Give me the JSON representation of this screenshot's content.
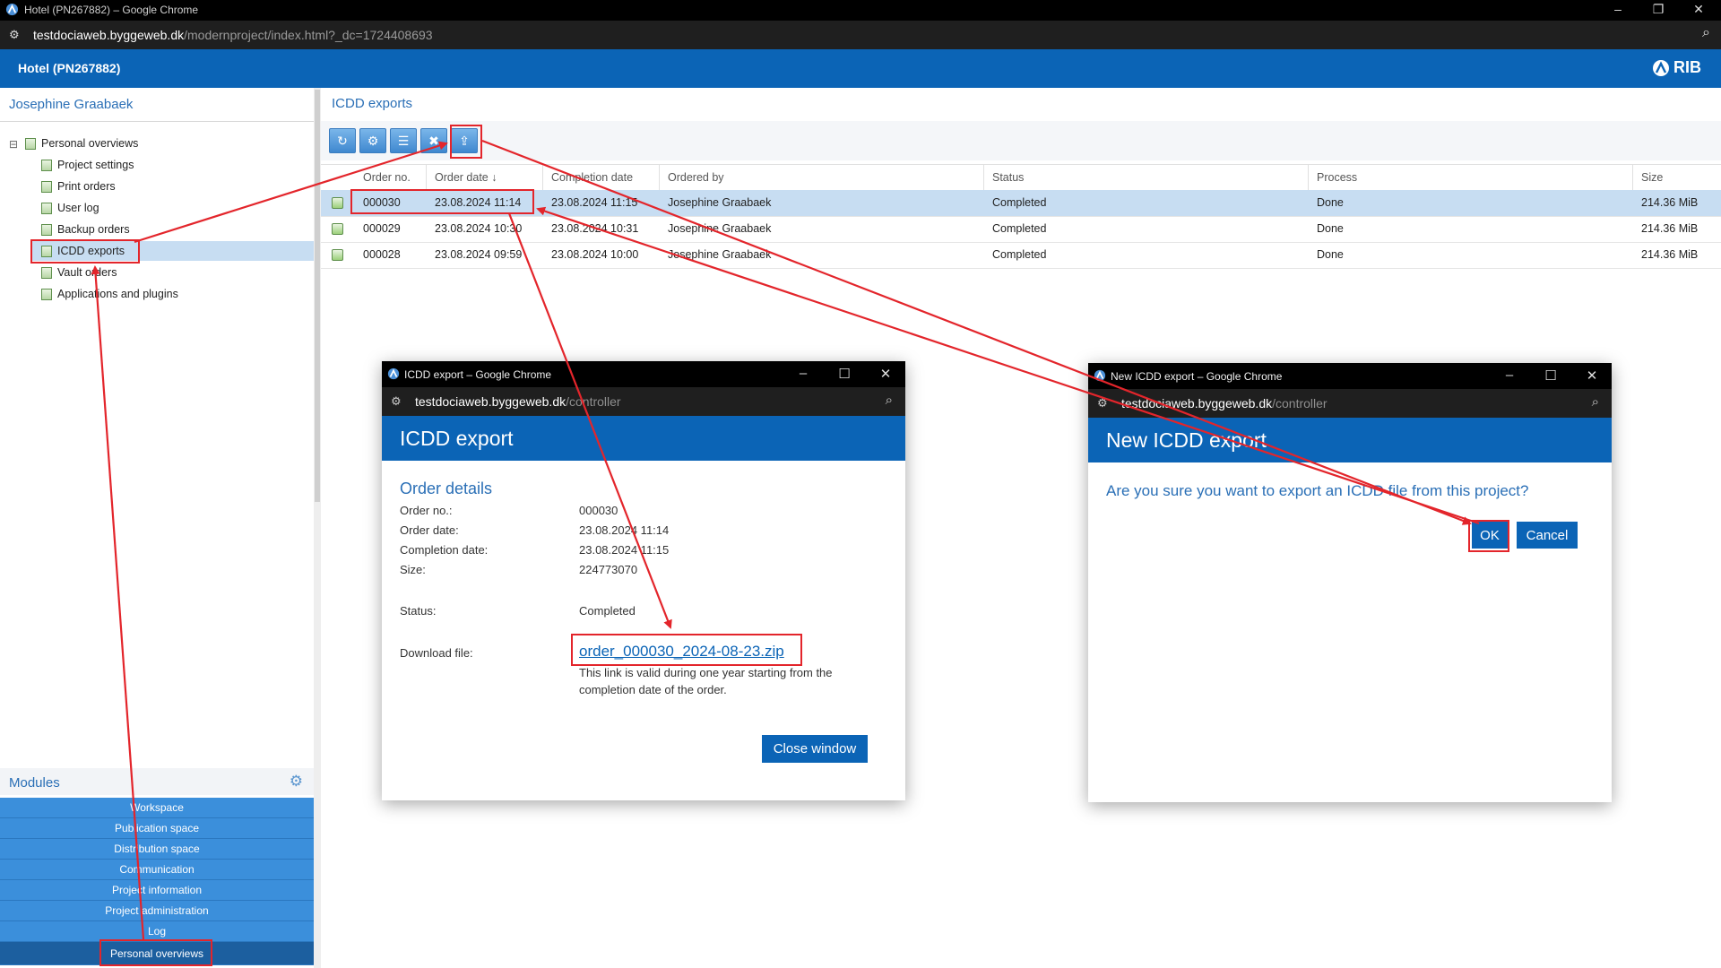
{
  "browser": {
    "window_title": "Hotel (PN267882) – Google Chrome",
    "url_host": "testdociaweb.byggeweb.dk",
    "url_path": "/modernproject/index.html?_dc=1724408693"
  },
  "app": {
    "project_title": "Hotel (PN267882)",
    "brand": "RIB"
  },
  "sidebar": {
    "user_name": "Josephine Graabaek",
    "root": "Personal overviews",
    "items": [
      {
        "label": "Project settings"
      },
      {
        "label": "Print orders"
      },
      {
        "label": "User log"
      },
      {
        "label": "Backup orders"
      },
      {
        "label": "ICDD exports"
      },
      {
        "label": "Vault orders"
      },
      {
        "label": "Applications and plugins"
      }
    ]
  },
  "modules": {
    "title": "Modules",
    "items": [
      {
        "label": "Workspace"
      },
      {
        "label": "Publication space"
      },
      {
        "label": "Distribution space"
      },
      {
        "label": "Communication"
      },
      {
        "label": "Project information"
      },
      {
        "label": "Project administration"
      },
      {
        "label": "Log"
      },
      {
        "label": "Personal overviews"
      }
    ]
  },
  "main": {
    "title": "ICDD exports",
    "columns": [
      "Order no.",
      "Order date ↓",
      "Completion date",
      "Ordered by",
      "Status",
      "Process",
      "Size"
    ],
    "rows": [
      {
        "order_no": "000030",
        "order_date": "23.08.2024 11:14",
        "completion_date": "23.08.2024 11:15",
        "ordered_by": "Josephine Graabaek",
        "status": "Completed",
        "process": "Done",
        "size": "214.36 MiB"
      },
      {
        "order_no": "000029",
        "order_date": "23.08.2024 10:30",
        "completion_date": "23.08.2024 10:31",
        "ordered_by": "Josephine Graabaek",
        "status": "Completed",
        "process": "Done",
        "size": "214.36 MiB"
      },
      {
        "order_no": "000028",
        "order_date": "23.08.2024 09:59",
        "completion_date": "23.08.2024 10:00",
        "ordered_by": "Josephine Graabaek",
        "status": "Completed",
        "process": "Done",
        "size": "214.36 MiB"
      }
    ]
  },
  "popup_export": {
    "window_title": "ICDD export – Google Chrome",
    "url_host": "testdociaweb.byggeweb.dk",
    "url_path": "/controller",
    "heading": "ICDD export",
    "section": "Order details",
    "labels": {
      "order_no": "Order no.:",
      "order_date": "Order date:",
      "completion_date": "Completion date:",
      "size": "Size:",
      "status": "Status:",
      "download": "Download file:"
    },
    "values": {
      "order_no": "000030",
      "order_date": "23.08.2024 11:14",
      "completion_date": "23.08.2024 11:15",
      "size": "224773070",
      "status": "Completed",
      "download_link": "order_000030_2024-08-23.zip",
      "download_note": "This link is valid during one year starting from the completion date of the order."
    },
    "close_button": "Close window"
  },
  "popup_new": {
    "window_title": "New ICDD export – Google Chrome",
    "url_host": "testdociaweb.byggeweb.dk",
    "url_path": "/controller",
    "heading": "New ICDD export",
    "question": "Are you sure you want to export an ICDD file from this project?",
    "ok_button": "OK",
    "cancel_button": "Cancel"
  },
  "colors": {
    "header_blue": "#0b64b6",
    "module_blue": "#3b8fdb",
    "selection": "#c7ddf2",
    "annotation_red": "#e3252b"
  }
}
